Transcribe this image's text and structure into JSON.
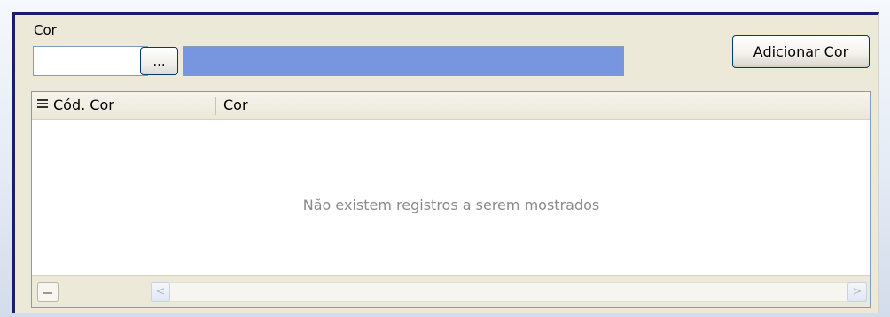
{
  "group": {
    "label": "Cor"
  },
  "code_input": {
    "value": ""
  },
  "lookup_button": {
    "label": "..."
  },
  "description_field": {
    "value": "",
    "background_color": "#7896df"
  },
  "add_button": {
    "mnemonic": "A",
    "label_rest": "dicionar Cor"
  },
  "grid": {
    "columns": [
      {
        "label": "Cód. Cor"
      },
      {
        "label": "Cor"
      }
    ],
    "rows": [],
    "empty_message": "Não existem registros a serem mostrados"
  },
  "scrollbar": {
    "left_arrow": "<",
    "right_arrow": ">"
  },
  "icons": [
    "column-chooser-icon",
    "collapse-icon",
    "scroll-left-icon",
    "scroll-right-icon"
  ]
}
